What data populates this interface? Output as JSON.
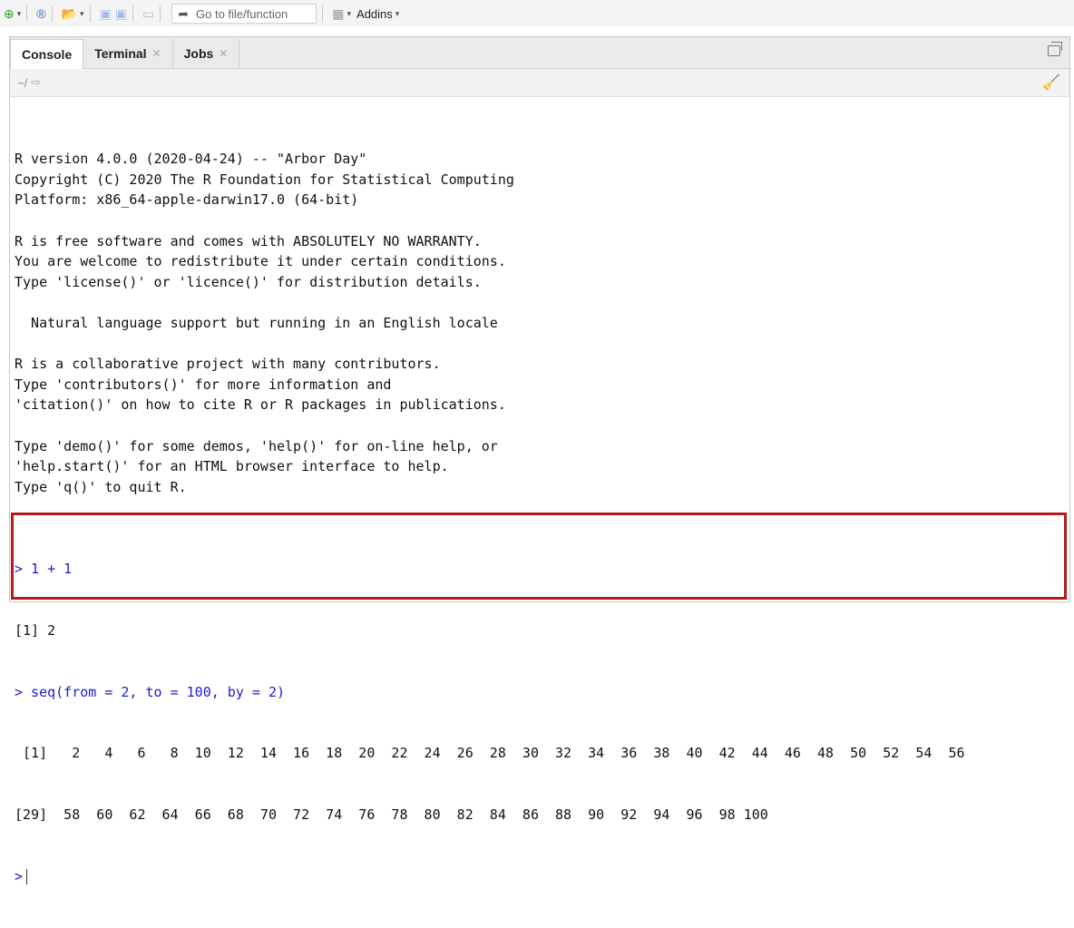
{
  "toolbar": {
    "goto_placeholder": "Go to file/function",
    "addins_label": "Addins"
  },
  "tabs": [
    {
      "label": "Console",
      "active": true
    },
    {
      "label": "Terminal",
      "closable": true
    },
    {
      "label": "Jobs",
      "closable": true
    }
  ],
  "path": "~/",
  "console": {
    "startup": [
      "R version 4.0.0 (2020-04-24) -- \"Arbor Day\"",
      "Copyright (C) 2020 The R Foundation for Statistical Computing",
      "Platform: x86_64-apple-darwin17.0 (64-bit)",
      "",
      "R is free software and comes with ABSOLUTELY NO WARRANTY.",
      "You are welcome to redistribute it under certain conditions.",
      "Type 'license()' or 'licence()' for distribution details.",
      "",
      "  Natural language support but running in an English locale",
      "",
      "R is a collaborative project with many contributors.",
      "Type 'contributors()' for more information and",
      "'citation()' on how to cite R or R packages in publications.",
      "",
      "Type 'demo()' for some demos, 'help()' for on-line help, or",
      "'help.start()' for an HTML browser interface to help.",
      "Type 'q()' to quit R.",
      ""
    ],
    "cmd1": "> 1 + 1",
    "out1": "[1] 2",
    "cmd2": "> seq(from = 2, to = 100, by = 2)",
    "out2a": " [1]   2   4   6   8  10  12  14  16  18  20  22  24  26  28  30  32  34  36  38  40  42  44  46  48  50  52  54  56",
    "out2b": "[29]  58  60  62  64  66  68  70  72  74  76  78  80  82  84  86  88  90  92  94  96  98 100",
    "prompt": ">"
  },
  "colors": {
    "prompt": "#1a1ad6",
    "highlight_border": "#b31b1b"
  }
}
